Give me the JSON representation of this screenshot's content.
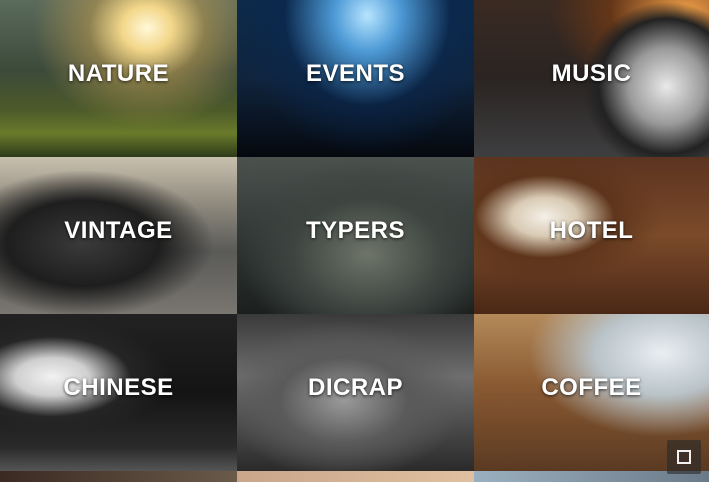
{
  "tiles": [
    {
      "label": "NATURE"
    },
    {
      "label": "EVENTS"
    },
    {
      "label": "MUSIC"
    },
    {
      "label": "VINTAGE"
    },
    {
      "label": "TYPERS"
    },
    {
      "label": "HOTEL"
    },
    {
      "label": "CHINESE"
    },
    {
      "label": "DICRAP"
    },
    {
      "label": "COFFEE"
    }
  ],
  "overlay": {
    "icon": "square-icon"
  }
}
